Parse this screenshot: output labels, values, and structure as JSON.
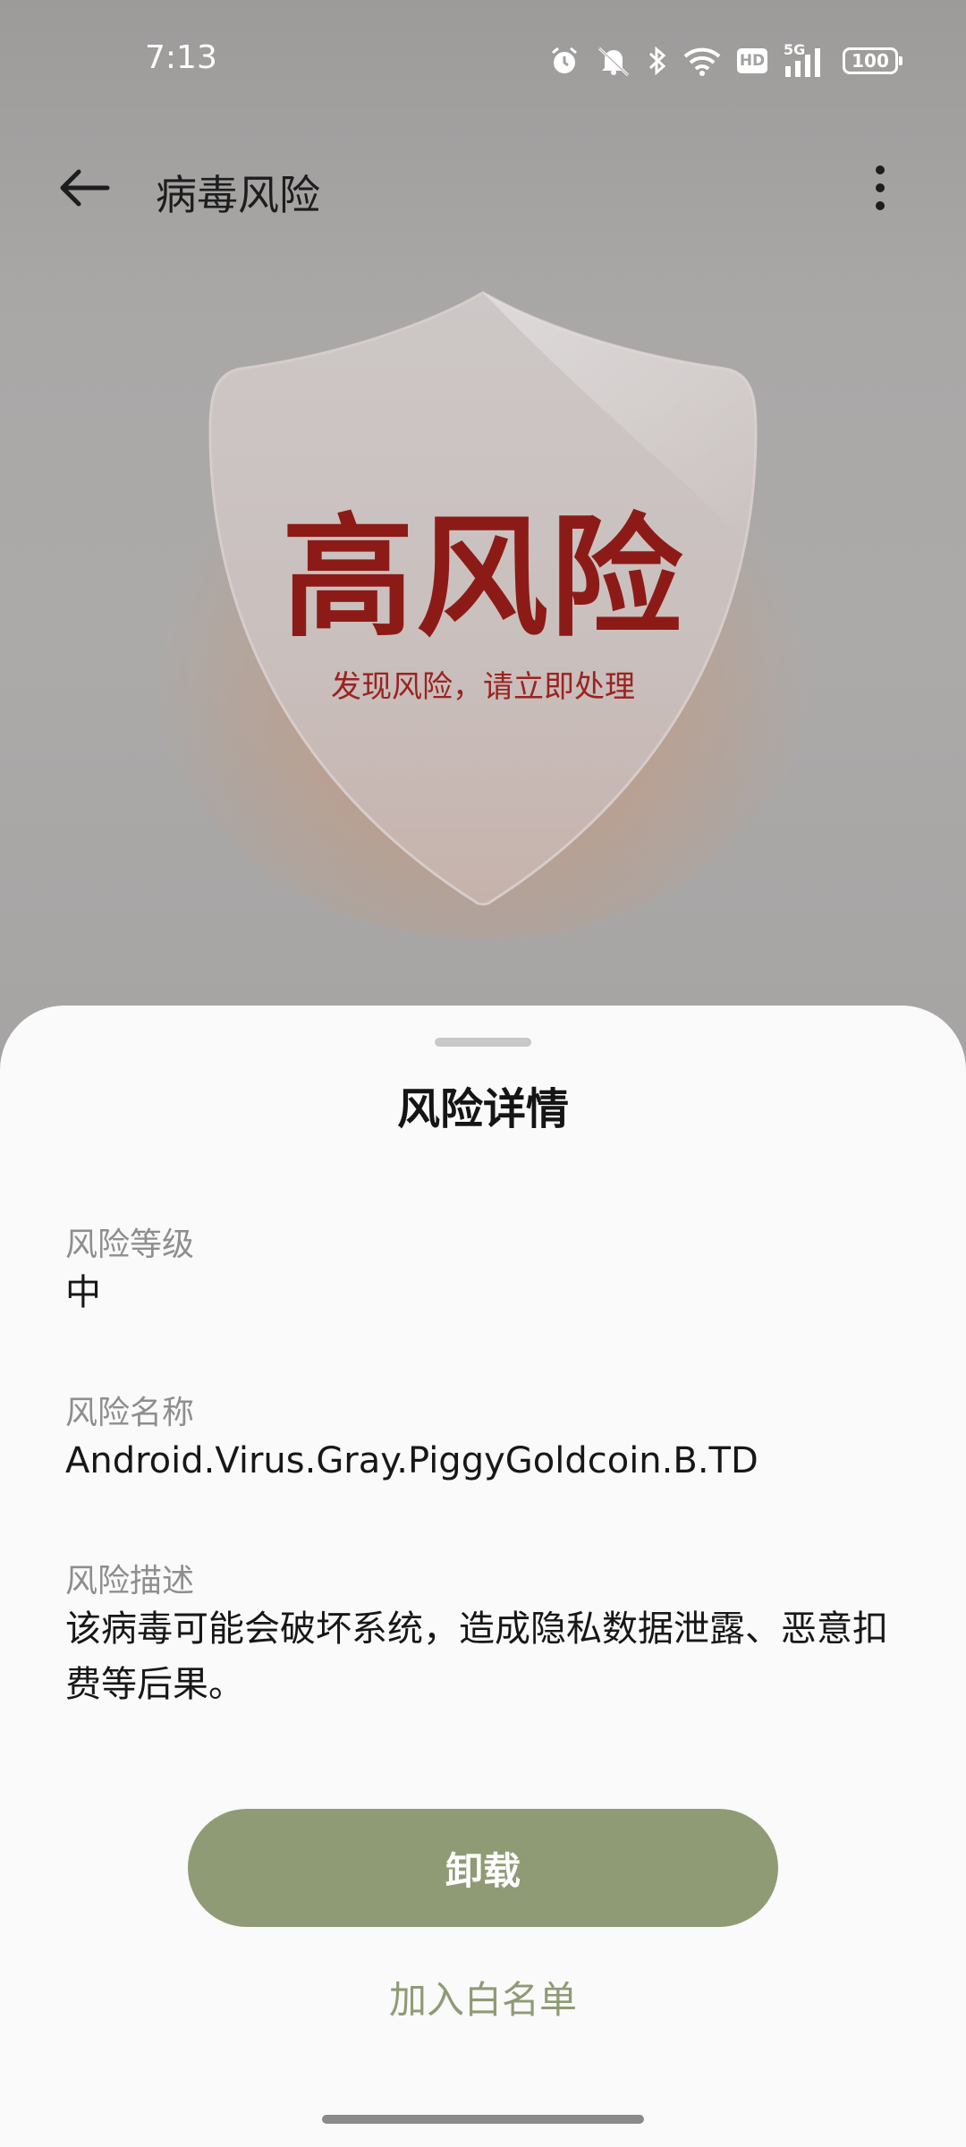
{
  "status_bar": {
    "time": "7:13",
    "network": "5G",
    "hd_badge": "HD",
    "battery": "100",
    "icons": [
      "alarm-icon",
      "mute-icon",
      "bluetooth-icon",
      "wifi-icon",
      "hd-icon",
      "signal-icon",
      "battery-icon"
    ]
  },
  "header": {
    "title": "病毒风险",
    "back_icon": "arrow-left-icon",
    "menu_icon": "more-vertical-icon"
  },
  "hero": {
    "risk_level_title": "高风险",
    "subtitle": "发现风险，请立即处理",
    "accent_color": "#8c1b17",
    "glow_color": "#eb7d3c"
  },
  "sheet": {
    "title": "风险详情",
    "fields": [
      {
        "label": "风险等级",
        "value": "中"
      },
      {
        "label": "风险名称",
        "value": "Android.Virus.Gray.PiggyGoldcoin.B.TD"
      },
      {
        "label": "风险描述",
        "value": "该病毒可能会破坏系统，造成隐私数据泄露、恶意扣费等后果。"
      }
    ],
    "primary_button": "卸载",
    "secondary_button": "加入白名单",
    "button_color": "#8f9b75"
  }
}
